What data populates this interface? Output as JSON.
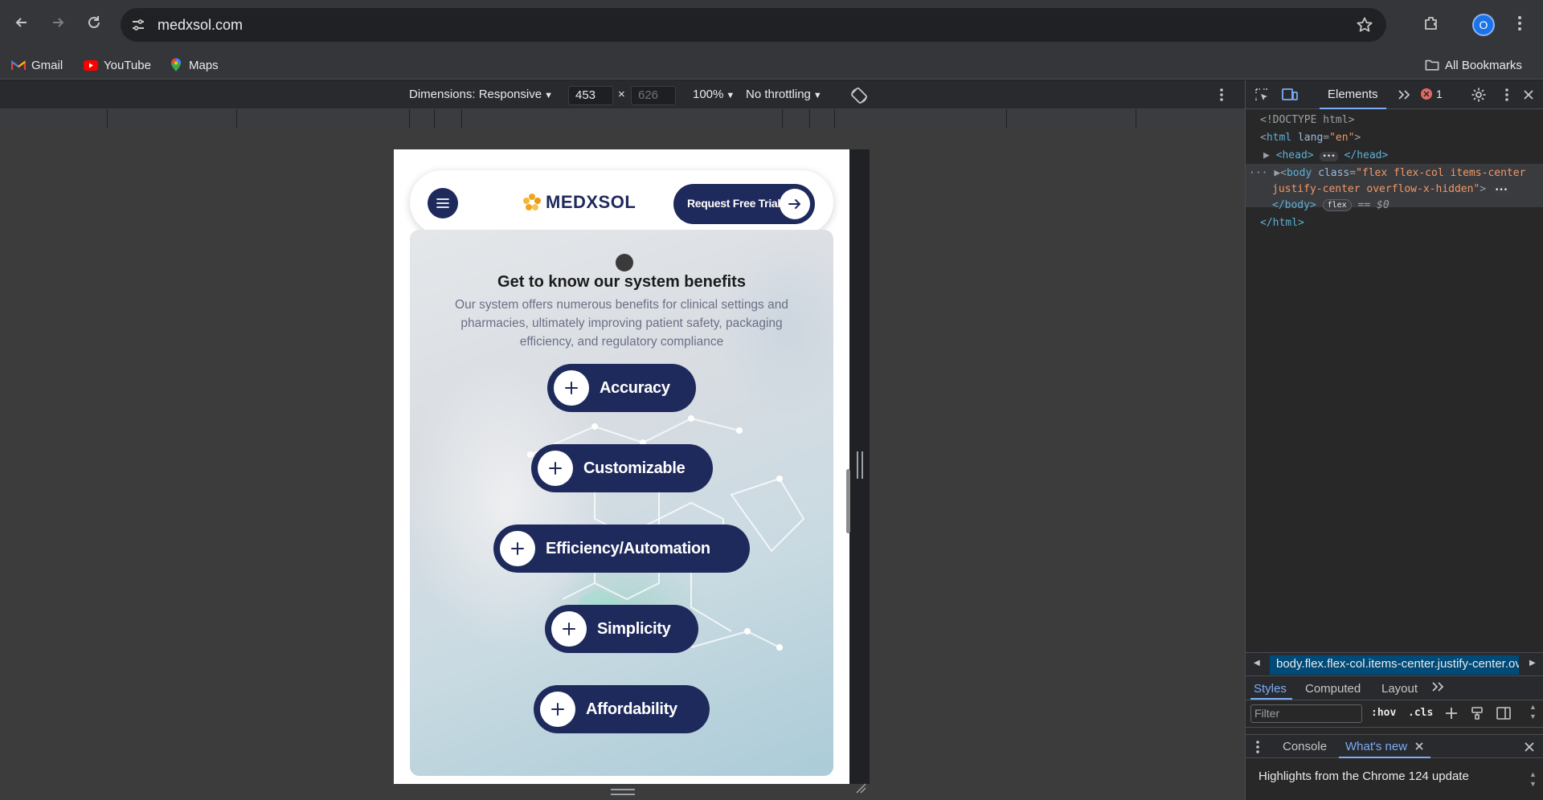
{
  "browser": {
    "url": "medxsol.com",
    "profile_initial": "O",
    "bookmarks": [
      {
        "label": "Gmail"
      },
      {
        "label": "YouTube"
      },
      {
        "label": "Maps"
      }
    ],
    "all_bookmarks_label": "All Bookmarks"
  },
  "device_toolbar": {
    "dimensions_label": "Dimensions: Responsive",
    "width": "453",
    "height_placeholder": "626",
    "times": "×",
    "zoom": "100%",
    "throttling": "No throttling"
  },
  "site": {
    "logo_text": "MEDXSOL",
    "cta_label": "Request Free Trial",
    "hero_title": "Get to know our system benefits",
    "hero_description": "Our system offers numerous benefits for clinical settings and pharmacies, ultimately improving patient safety, packaging efficiency, and regulatory compliance",
    "benefits": [
      {
        "label": "Accuracy"
      },
      {
        "label": "Customizable"
      },
      {
        "label": "Efficiency/Automation"
      },
      {
        "label": "Simplicity"
      },
      {
        "label": "Affordability"
      }
    ]
  },
  "devtools": {
    "active_tab": "Elements",
    "error_count": "1",
    "dom": {
      "doctype": "<!DOCTYPE html>",
      "html_open_tag": "html",
      "html_attr_name": "lang",
      "html_attr_value": "\"en\"",
      "head_open": "<head>",
      "head_close": "</head>",
      "body_tag": "body",
      "body_attr_name": "class",
      "body_attr_value_line1": "\"flex flex-col items-center",
      "body_attr_value_line2": "justify-center overflow-x-hidden\"",
      "body_close": "</body>",
      "flex_badge": "flex",
      "selected_marker": "== $0",
      "html_close": "</html>"
    },
    "breadcrumb": "body.flex.flex-col.items-center.justify-center.overflow-x-hidden",
    "styles_tabs": [
      "Styles",
      "Computed",
      "Layout"
    ],
    "filter_placeholder": "Filter",
    "filter_hov": ":hov",
    "filter_cls": ".cls",
    "drawer_tabs": [
      "Console",
      "What's new"
    ],
    "whats_new_text": "Highlights from the Chrome 124 update"
  },
  "colors": {
    "brand_navy": "#1f2a5c",
    "logo_orange": "#f2a51a",
    "devtools_accent": "#7cacf8",
    "error_red": "#e46962"
  }
}
